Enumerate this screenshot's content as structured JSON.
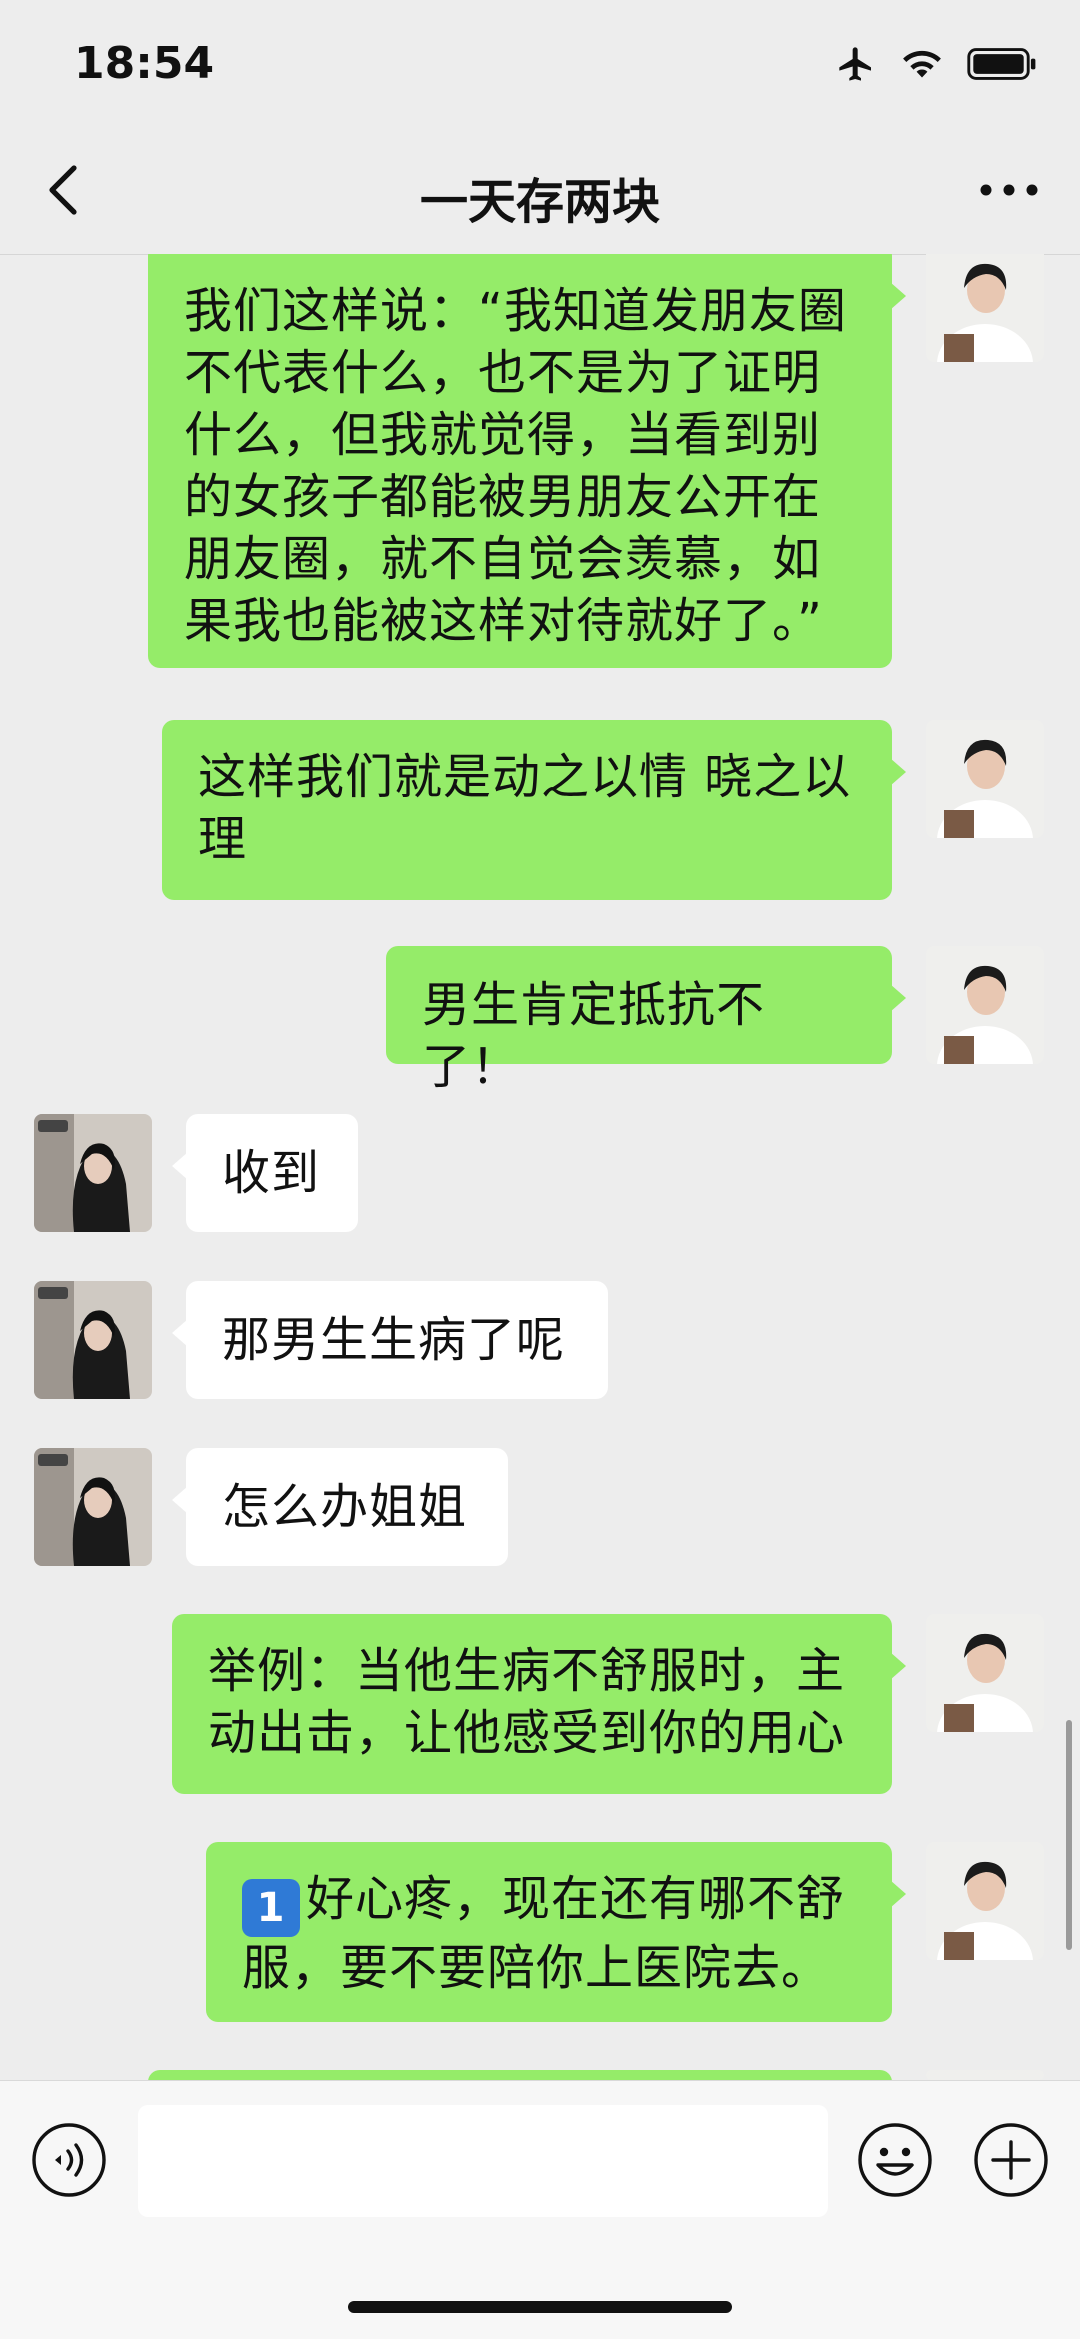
{
  "status_bar": {
    "time": "18:54",
    "icons": [
      "airplane-icon",
      "wifi-icon",
      "battery-icon"
    ]
  },
  "nav": {
    "title": "一天存两块",
    "back_icon": "chevron-left-icon",
    "more_icon": "more-icon"
  },
  "messages": [
    {
      "side": "right",
      "sender": "me",
      "text": "我们这样说：“我知道发朋友圈不代表什么，也不是为了证明什么，但我就觉得，当看到别的女孩子都能被男朋友公开在朋友圈，就不自觉会羡慕，如果我也能被这样对待就好了。”",
      "lines": [
        "我们这样说：“我知道发朋友圈",
        "不代表什么，也不是为了证明",
        "什么，但我就觉得，当看到别",
        "的女孩子都能被男朋友公开在",
        "朋友圈，就不自觉会羡慕，如",
        "果我也能被这样对待就好了。”"
      ]
    },
    {
      "side": "right",
      "sender": "me",
      "lines": [
        "这样我们就是动之以情 晓之以",
        "理"
      ]
    },
    {
      "side": "right",
      "sender": "me",
      "lines": [
        "男生肯定抵抗不了！"
      ]
    },
    {
      "side": "left",
      "sender": "other",
      "lines": [
        "收到"
      ]
    },
    {
      "side": "left",
      "sender": "other",
      "lines": [
        "那男生生病了呢"
      ]
    },
    {
      "side": "left",
      "sender": "other",
      "lines": [
        "怎么办姐姐"
      ]
    },
    {
      "side": "right",
      "sender": "me",
      "lines": [
        "举例：当他生病不舒服时，主",
        "动出击，让他感受到你的用心"
      ]
    },
    {
      "side": "right",
      "sender": "me",
      "keycap": "1",
      "lines": [
        "好心疼，现在还有哪不舒",
        "服，要不要陪你上医院去。"
      ]
    }
  ],
  "input_bar": {
    "value": "",
    "voice_icon": "voice-icon",
    "emoji_icon": "emoji-icon",
    "plus_icon": "plus-icon"
  },
  "colors": {
    "background": "#EDEDED",
    "my_bubble": "#95EC69",
    "their_bubble": "#FFFFFF",
    "text": "#111111"
  }
}
